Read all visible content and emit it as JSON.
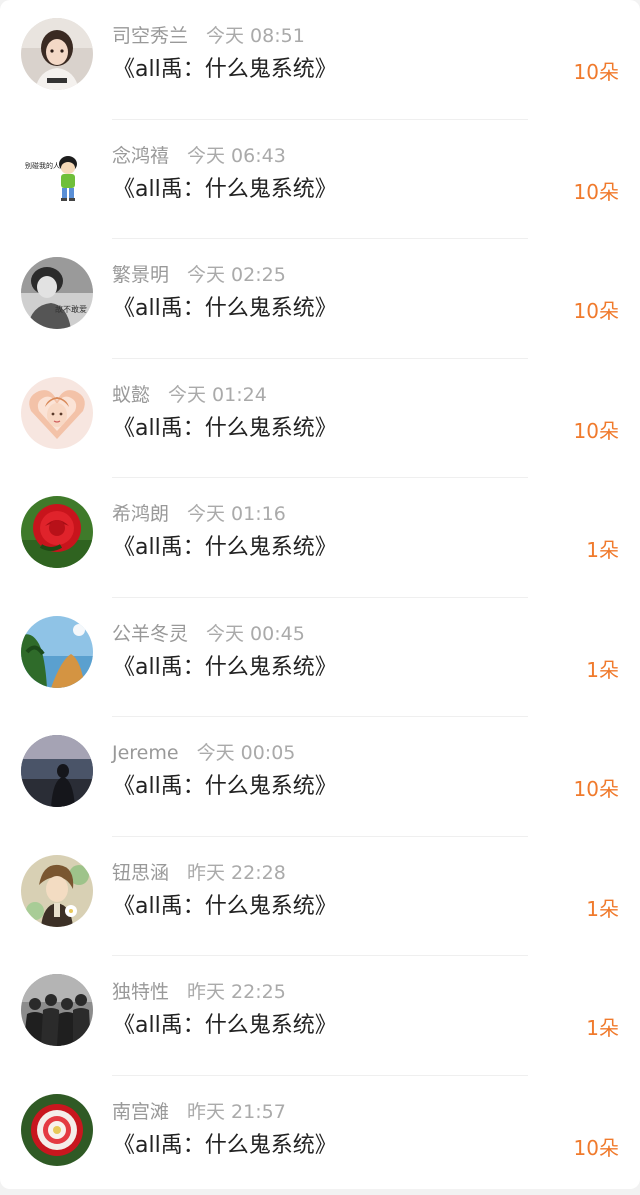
{
  "list": [
    {
      "username": "司空秀兰",
      "time": "今天 08:51",
      "title": "《all禹：什么鬼系统》",
      "gift": "10朵",
      "avatar_icon": "child-photo-avatar"
    },
    {
      "username": "念鸿禧",
      "time": "今天 06:43",
      "title": "《all禹：什么鬼系统》",
      "gift": "10朵",
      "avatar_icon": "cartoon-avatar"
    },
    {
      "username": "繁景明",
      "time": "今天 02:25",
      "title": "《all禹：什么鬼系统》",
      "gift": "10朵",
      "avatar_icon": "bw-portrait-avatar"
    },
    {
      "username": "蚁懿",
      "time": "今天 01:24",
      "title": "《all禹：什么鬼系统》",
      "gift": "10朵",
      "avatar_icon": "heart-hands-avatar"
    },
    {
      "username": "希鸿朗",
      "time": "今天 01:16",
      "title": "《all禹：什么鬼系统》",
      "gift": "1朵",
      "avatar_icon": "red-rose-avatar"
    },
    {
      "username": "公羊冬灵",
      "time": "今天 00:45",
      "title": "《all禹：什么鬼系统》",
      "gift": "1朵",
      "avatar_icon": "landscape-avatar"
    },
    {
      "username": "Jereme",
      "time": "今天 00:05",
      "title": "《all禹：什么鬼系统》",
      "gift": "10朵",
      "avatar_icon": "sea-silhouette-avatar"
    },
    {
      "username": "钮思涵",
      "time": "昨天 22:28",
      "title": "《all禹：什么鬼系统》",
      "gift": "1朵",
      "avatar_icon": "anime-avatar"
    },
    {
      "username": "独特性",
      "time": "昨天 22:25",
      "title": "《all禹：什么鬼系统》",
      "gift": "1朵",
      "avatar_icon": "group-photo-avatar"
    },
    {
      "username": "南宫滩",
      "time": "昨天 21:57",
      "title": "《all禹：什么鬼系统》",
      "gift": "10朵",
      "avatar_icon": "red-white-flower-avatar"
    }
  ]
}
